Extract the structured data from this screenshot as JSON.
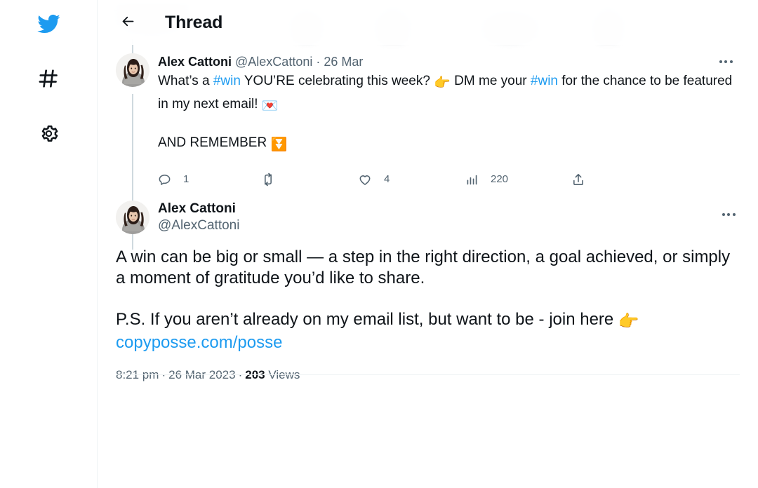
{
  "sidebar": {
    "items": [
      {
        "name": "twitter-logo",
        "label": "Twitter",
        "color": "#1d9bf0"
      },
      {
        "name": "explore",
        "label": "Explore",
        "color": "#0f1419"
      },
      {
        "name": "settings",
        "label": "Settings",
        "color": "#0f1419"
      }
    ]
  },
  "header": {
    "back_label": "Back",
    "title": "Thread"
  },
  "colors": {
    "accent": "#1d9bf0",
    "text": "#0f1419",
    "muted": "#536471",
    "thread_line": "#cfd9de",
    "divider": "#eff3f4"
  },
  "tweets": [
    {
      "id": "parent-tweet",
      "display_name": "Alex Cattoni",
      "handle": "@AlexCattoni",
      "separator": "·",
      "date": "26 Mar",
      "more_label": "More",
      "text_parts": [
        {
          "type": "text",
          "value": "What’s a "
        },
        {
          "type": "link",
          "value": "#win"
        },
        {
          "type": "text",
          "value": " YOU’RE celebrating this week? "
        },
        {
          "type": "emoji",
          "value": "👉"
        },
        {
          "type": "text",
          "value": " DM me your "
        },
        {
          "type": "link",
          "value": "#win"
        },
        {
          "type": "text",
          "value": " for the chance to be featured in my next email! "
        },
        {
          "type": "emoji",
          "value": "💌"
        }
      ],
      "text_line2": "AND REMEMBER ",
      "text_line2_emoji": "⏬",
      "actions": {
        "reply": {
          "label": "Reply",
          "count": "1"
        },
        "retweet": {
          "label": "Retweet",
          "count": ""
        },
        "like": {
          "label": "Like",
          "count": "4"
        },
        "views": {
          "label": "View Tweet analytics",
          "count": "220"
        },
        "share": {
          "label": "Share",
          "count": ""
        }
      }
    },
    {
      "id": "focused-tweet",
      "display_name": "Alex Cattoni",
      "handle": "@AlexCattoni",
      "more_label": "More",
      "paragraph1": "A win can be big or small — a step in the right direction, a goal achieved, or simply a moment of gratitude you’d like to share.",
      "paragraph2_prefix": "P.S. If you aren’t already on my email list, but want to be - join here ",
      "paragraph2_emoji": "👉",
      "link_text": "copyposse.com/posse",
      "meta": {
        "time": "8:21 pm",
        "sep1": "·",
        "date": "26 Mar 2023",
        "sep2": "·",
        "views_count": "203",
        "views_label": "Views"
      }
    }
  ]
}
